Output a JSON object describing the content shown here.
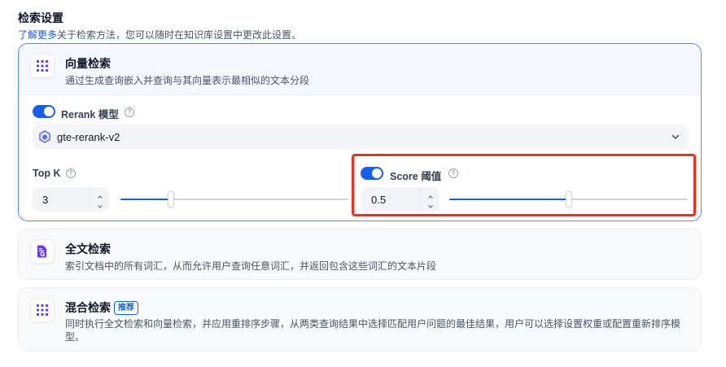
{
  "header": {
    "title": "检索设置",
    "learn_more": "了解更多",
    "subtitle_rest": "关于检索方法，您可以随时在知识库设置中更改此设置。"
  },
  "vector": {
    "name": "向量检索",
    "desc": "通过生成查询嵌入并查询与其向量表示最相似的文本分段",
    "icon": "grid-icon",
    "rerank_label": "Rerank 模型",
    "rerank_enabled": true,
    "model_icon": "model-logo-icon",
    "model_value": "gte-rerank-v2",
    "topk_label": "Top K",
    "topk_value": "3",
    "topk_fraction": 0.22,
    "score_label": "Score 阈值",
    "score_enabled": true,
    "score_value": "0.5",
    "score_fraction": 0.5
  },
  "fulltext": {
    "name": "全文检索",
    "desc": "索引文档中的所有词汇，从而允许用户查询任意词汇，并返回包含这些词汇的文本片段",
    "icon": "document-search-icon"
  },
  "hybrid": {
    "name": "混合检索",
    "badge": "推荐",
    "desc_line1": "同时执行全文检索和向量检索，并应用重排序步骤，从两类查询结果中选择匹配用户问题的最佳结果，用户可以选择设置权重或配置重新排序模",
    "desc_line2": "型。",
    "icon": "grid-icon"
  },
  "colors": {
    "accent": "#155eef",
    "icon_purple": "#6938ef",
    "highlight_red": "#ff2a1a"
  }
}
